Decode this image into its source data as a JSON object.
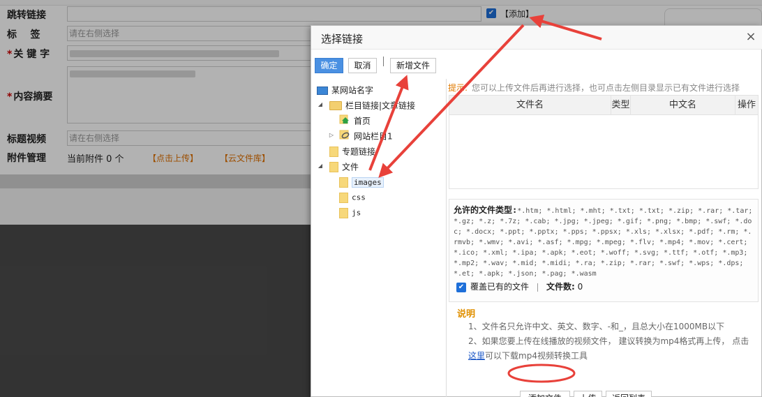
{
  "background_form": {
    "fields": [
      {
        "label": "跳转链接",
        "required": false,
        "placeholder": ""
      },
      {
        "label": "标    签",
        "required": false,
        "placeholder": "请在右侧选择"
      },
      {
        "label": "关 键 字",
        "required": true,
        "placeholder": ""
      },
      {
        "label": "内容摘要",
        "required": true,
        "placeholder": ""
      },
      {
        "label": "标题视频",
        "required": false,
        "placeholder": "请在右侧选择"
      },
      {
        "label": "附件管理",
        "required": false,
        "placeholder": ""
      }
    ],
    "add_checkbox_label": "【添加】",
    "attachment_count": "当前附件 0 个",
    "upload_link": "【点击上传】",
    "cloud_link": "【云文件库】"
  },
  "dialog": {
    "title": "选择链接",
    "close_glyph": "×",
    "toolbar": {
      "confirm": "确定",
      "cancel": "取消",
      "separator": "|",
      "new_file": "新增文件"
    },
    "tree": {
      "root": "某网站名字",
      "nodes": [
        {
          "label": "栏目链接|文章链接",
          "icon": "folder-open-icon",
          "expander": "◢"
        },
        {
          "label": "首页",
          "icon": "home-icon"
        },
        {
          "label": "网站栏目1",
          "icon": "link-folder-icon",
          "expander": "▷"
        },
        {
          "label": "专题链接",
          "icon": "folder-icon"
        },
        {
          "label": "文件",
          "icon": "folder-icon",
          "expander": "◢"
        },
        {
          "label": "images",
          "icon": "folder-icon",
          "selected": true
        },
        {
          "label": "css",
          "icon": "folder-icon"
        },
        {
          "label": "js",
          "icon": "folder-icon"
        }
      ]
    },
    "tip": {
      "head": "提示:",
      "text": "您可以上传文件后再进行选择，也可点击左侧目录显示已有文件进行选择"
    },
    "table": {
      "headers": [
        "文件名",
        "类型",
        "中文名",
        "操作"
      ]
    },
    "allowed_types": {
      "heading": "允许的文件类型:",
      "types": "*.htm; *.html; *.mht; *.txt; *.txt; *.zip; *.rar; *.tar; *.gz; *.z; *.7z; *.cab; *.jpg; *.jpeg; *.gif; *.png; *.bmp; *.swf; *.doc; *.docx; *.ppt; *.pptx; *.pps; *.ppsx; *.xls; *.xlsx; *.pdf; *.rm; *.rmvb; *.wmv; *.avi; *.asf; *.mpg; *.mpeg; *.flv; *.mp4; *.mov; *.cert; *.ico; *.xml; *.ipa; *.apk; *.eot; *.woff; *.svg; *.ttf; *.otf; *.mp3; *.mp2; *.wav; *.mid; *.midi; *.ra; *.zip; *.rar; *.swf; *.wps; *.dps; *.et; *.apk; *.json; *.pag; *.wasm",
      "overwrite_label": "覆盖已有的文件",
      "file_count_label": "文件数:",
      "file_count_value": "0"
    },
    "notes": {
      "heading": "说明",
      "item1": "1、文件名只允许中文、英文、数字、-和_，且总大小在1000MB以下",
      "item2_part1": "2、如果您要上传在线播放的视频文件，  建议转换为mp4格式再上传，  点击",
      "item2_link": "这里",
      "item2_part2": "可以下载mp4视频转换工具"
    },
    "bottom_buttons": {
      "add_file": "添加文件",
      "upload": "上传",
      "back": "返回列表"
    }
  },
  "colors": {
    "annotation_red": "#e8413a",
    "accent_blue": "#4a90e2",
    "orange": "#e07000"
  }
}
